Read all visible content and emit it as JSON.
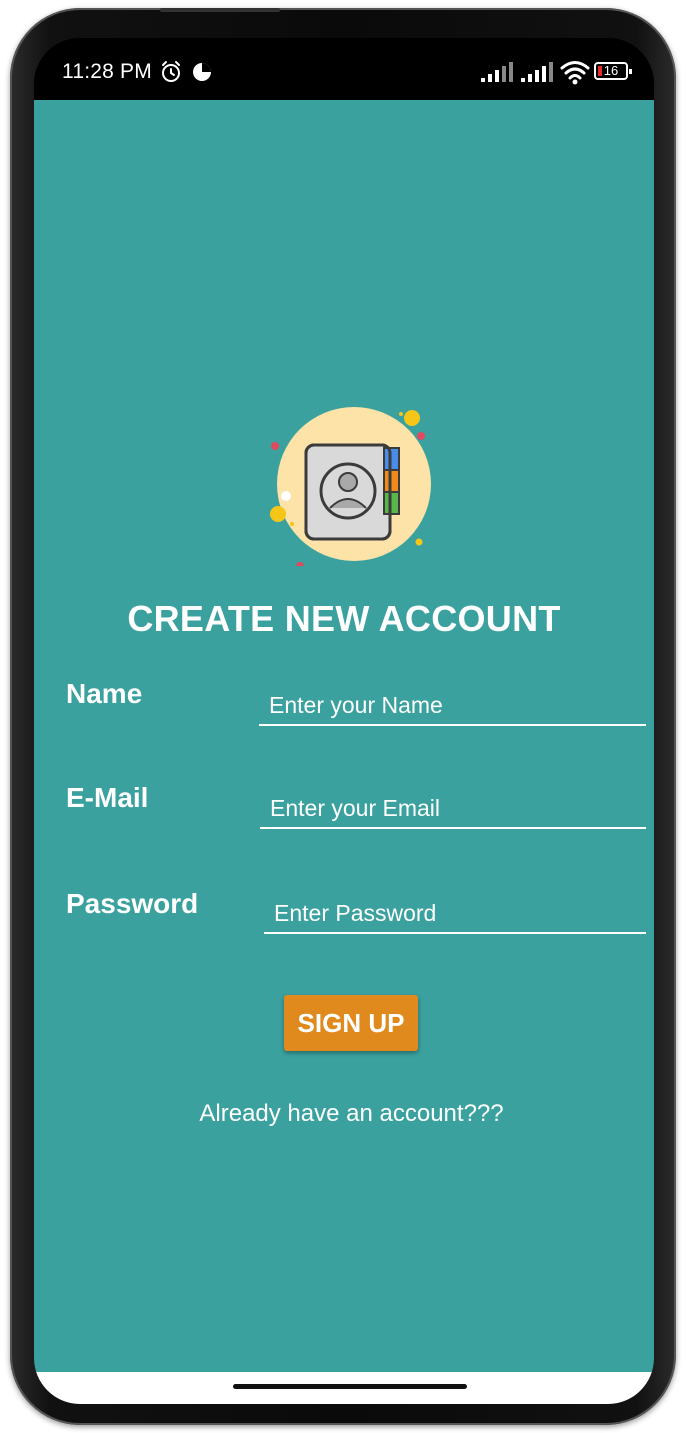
{
  "status_bar": {
    "time": "11:28 PM",
    "battery": "16",
    "icons": [
      "alarm-icon",
      "data-saver-icon",
      "signal-icon",
      "signal-icon",
      "wifi-icon",
      "battery-icon"
    ]
  },
  "app": {
    "background_color": "#3aa19f",
    "title": "CREATE NEW ACCOUNT",
    "logo_icon": "contact-book-icon",
    "form": {
      "name_label": "Name",
      "name_placeholder": "Enter your Name",
      "email_label": "E-Mail",
      "email_placeholder": "Enter your Email",
      "password_label": "Password",
      "password_placeholder": "Enter Password"
    },
    "signup_button": {
      "label": "SIGN UP",
      "color": "#e08a1e"
    },
    "login_link": "Already have an account???"
  }
}
